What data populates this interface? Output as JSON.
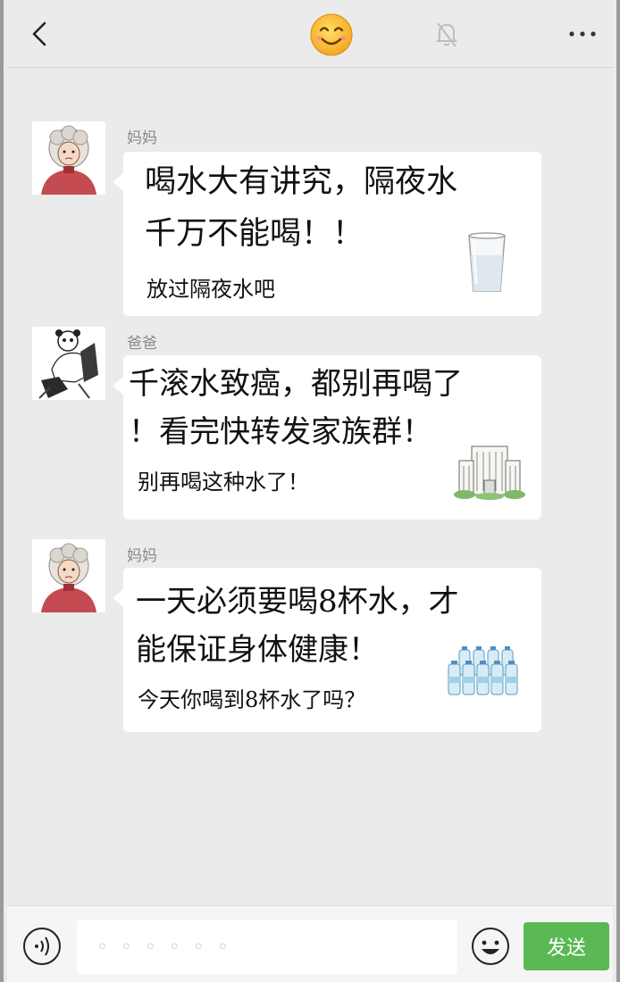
{
  "header": {
    "back_icon": "chevron-left-icon",
    "title_icon": "smiling-face-emoji",
    "mute_icon": "bell-off-icon",
    "more_label": "···"
  },
  "messages": [
    {
      "sender": "妈妈",
      "avatar": "grandma-cartoon-avatar",
      "big_text": [
        "喝水大有讲究，隔夜水",
        "千万不能喝！！"
      ],
      "small_text": "放过隔夜水吧",
      "illustration": "water-glass-illustration"
    },
    {
      "sender": "爸爸",
      "avatar": "panda-man-cartoon-avatar",
      "big_text": [
        "千滚水致癌，都别再喝了",
        "！看完快转发家族群！"
      ],
      "small_text": "别再喝这种水了！",
      "illustration": "hospital-building-illustration"
    },
    {
      "sender": "妈妈",
      "avatar": "grandma-cartoon-avatar",
      "big_text": [
        "一天必须要喝8杯水，才",
        "能保证身体健康！"
      ],
      "small_text": "今天你喝到8杯水了吗？",
      "illustration": "water-bottles-illustration"
    }
  ],
  "input_bar": {
    "voice_icon": "voice-input-icon",
    "input_value": "◦◦◦◦◦◦",
    "emoji_icon": "emoji-face-icon",
    "send_label": "发送",
    "send_color": "#5bb955"
  }
}
